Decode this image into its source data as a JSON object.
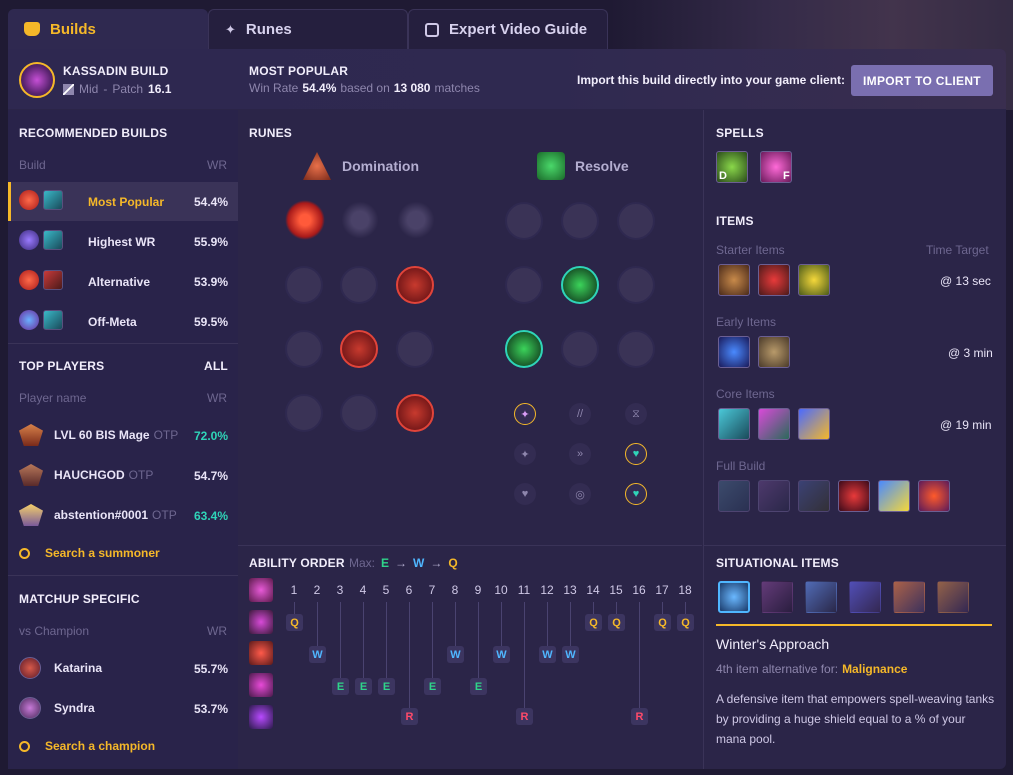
{
  "tabs": [
    {
      "label": "Builds"
    },
    {
      "label": "Runes"
    },
    {
      "label": "Expert Video Guide"
    }
  ],
  "header": {
    "title": "KASSADIN BUILD",
    "role": "Mid",
    "patch_label": "Patch",
    "patch": "16.1",
    "most_popular_label": "MOST POPULAR",
    "winrate_prefix": "Win Rate",
    "winrate": "54.4%",
    "based_on": "based on",
    "matches": "13 080",
    "matches_suffix": "matches",
    "import_text": "Import this build directly into your game client:",
    "import_button": "IMPORT TO CLIENT"
  },
  "recommended": {
    "title": "RECOMMENDED BUILDS",
    "col_build": "Build",
    "col_wr": "WR",
    "builds": [
      {
        "name": "Most Popular",
        "wr": "54.4%"
      },
      {
        "name": "Highest WR",
        "wr": "55.9%"
      },
      {
        "name": "Alternative",
        "wr": "53.9%"
      },
      {
        "name": "Off-Meta",
        "wr": "59.5%"
      }
    ]
  },
  "top_players": {
    "title": "TOP PLAYERS",
    "all": "ALL",
    "col_name": "Player name",
    "col_wr": "WR",
    "players": [
      {
        "name": "LVL 60 BIS Mage",
        "tag": "OTP",
        "wr": "72.0%"
      },
      {
        "name": "HAUCHGOD",
        "tag": "OTP",
        "wr": "54.7%"
      },
      {
        "name": "abstention#0001",
        "tag": "OTP",
        "wr": "63.4%"
      }
    ],
    "search": "Search a summoner"
  },
  "matchup": {
    "title": "MATCHUP SPECIFIC",
    "col_vs": "vs Champion",
    "col_wr": "WR",
    "champions": [
      {
        "name": "Katarina",
        "wr": "55.7%"
      },
      {
        "name": "Syndra",
        "wr": "53.7%"
      }
    ],
    "search": "Search a champion"
  },
  "runes": {
    "title": "RUNES",
    "primary": "Domination",
    "secondary": "Resolve"
  },
  "ability_order": {
    "title": "ABILITY ORDER",
    "max_label": "Max:",
    "max_seq": [
      "E",
      "W",
      "Q"
    ],
    "arrow": "→",
    "levels": [
      "1",
      "2",
      "3",
      "4",
      "5",
      "6",
      "7",
      "8",
      "9",
      "10",
      "11",
      "12",
      "13",
      "14",
      "15",
      "16",
      "17",
      "18"
    ],
    "q": "Q",
    "w": "W",
    "e": "E",
    "r": "R"
  },
  "spells": {
    "title": "SPELLS",
    "keys": [
      "D",
      "F"
    ]
  },
  "items": {
    "title": "ITEMS",
    "starter": "Starter Items",
    "time_target": "Time Target",
    "starter_time": "@ 13 sec",
    "early": "Early Items",
    "early_time": "@ 3 min",
    "core": "Core Items",
    "core_time": "@ 19 min",
    "full": "Full Build"
  },
  "situational": {
    "title": "SITUATIONAL ITEMS",
    "item_name": "Winter's Approach",
    "alt_prefix": "4th item alternative for:",
    "alt_item": "Malignance",
    "description": "A defensive item that empowers spell-weaving tanks by providing a huge shield equal to a % of your mana pool."
  },
  "colors": {
    "accent": "#f5b829",
    "green": "#2fd4b8",
    "q": "#f5b829",
    "w": "#4fb6ff",
    "e": "#2fd48a",
    "r": "#ff4a6a"
  }
}
